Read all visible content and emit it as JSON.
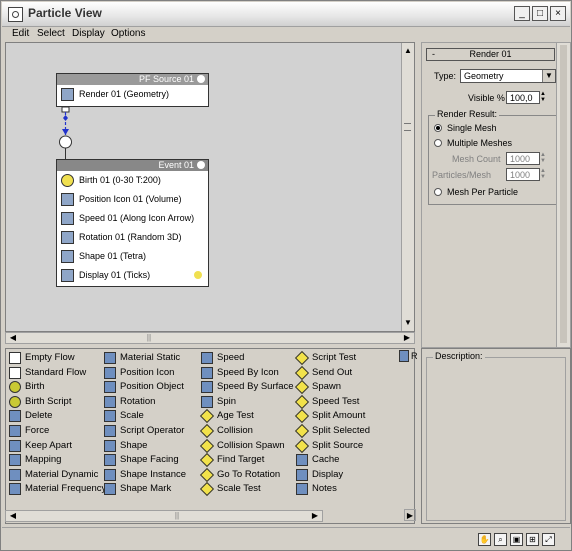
{
  "window": {
    "title": "Particle View"
  },
  "menu": [
    "Edit",
    "Select",
    "Display",
    "Options"
  ],
  "nodes": {
    "source": {
      "header": "PF Source 01",
      "rows": [
        {
          "label": "Render 01 (Geometry)",
          "icon": "render-icon"
        }
      ]
    },
    "event": {
      "header": "Event 01",
      "rows": [
        {
          "label": "Birth 01 (0-30 T:200)",
          "icon": "birth-icon"
        },
        {
          "label": "Position Icon 01 (Volume)",
          "icon": "position-icon"
        },
        {
          "label": "Speed 01 (Along Icon Arrow)",
          "icon": "speed-icon"
        },
        {
          "label": "Rotation 01 (Random 3D)",
          "icon": "rotation-icon"
        },
        {
          "label": "Shape 01 (Tetra)",
          "icon": "shape-icon"
        },
        {
          "label": "Display 01 (Ticks)",
          "icon": "display-icon"
        }
      ]
    }
  },
  "params": {
    "rollout_title": "Render 01",
    "rollout_toggle": "-",
    "type_label": "Type:",
    "type_value": "Geometry",
    "visible_label": "Visible %",
    "visible_value": "100,0",
    "render_result_label": "Render Result:",
    "options": [
      "Single Mesh",
      "Multiple Meshes"
    ],
    "mesh_count_label": "Mesh Count",
    "mesh_count_value": "1000",
    "particles_label": "Particles/Mesh",
    "particles_value": "1000",
    "mesh_per_particle": "Mesh Per Particle"
  },
  "depot": {
    "columns": [
      [
        {
          "label": "Empty Flow",
          "icon": "empty-flow-icon",
          "kind": "op"
        },
        {
          "label": "Standard Flow",
          "icon": "standard-flow-icon",
          "kind": "op"
        },
        {
          "label": "Birth",
          "icon": "birth-icon",
          "kind": "birth"
        },
        {
          "label": "Birth Script",
          "icon": "birth-script-icon",
          "kind": "birth"
        },
        {
          "label": "Delete",
          "icon": "delete-icon",
          "kind": "normal"
        },
        {
          "label": "Force",
          "icon": "force-icon",
          "kind": "normal"
        },
        {
          "label": "Keep Apart",
          "icon": "keep-apart-icon",
          "kind": "normal"
        },
        {
          "label": "Mapping",
          "icon": "mapping-icon",
          "kind": "normal"
        },
        {
          "label": "Material Dynamic",
          "icon": "material-dynamic-icon",
          "kind": "normal"
        },
        {
          "label": "Material Frequency",
          "icon": "material-frequency-icon",
          "kind": "normal"
        }
      ],
      [
        {
          "label": "Material Static",
          "icon": "material-static-icon",
          "kind": "normal"
        },
        {
          "label": "Position Icon",
          "icon": "position-icon",
          "kind": "normal"
        },
        {
          "label": "Position Object",
          "icon": "position-object-icon",
          "kind": "normal"
        },
        {
          "label": "Rotation",
          "icon": "rotation-icon",
          "kind": "normal"
        },
        {
          "label": "Scale",
          "icon": "scale-icon",
          "kind": "normal"
        },
        {
          "label": "Script Operator",
          "icon": "script-operator-icon",
          "kind": "normal"
        },
        {
          "label": "Shape",
          "icon": "shape-icon",
          "kind": "normal"
        },
        {
          "label": "Shape Facing",
          "icon": "shape-facing-icon",
          "kind": "normal"
        },
        {
          "label": "Shape Instance",
          "icon": "shape-instance-icon",
          "kind": "normal"
        },
        {
          "label": "Shape Mark",
          "icon": "shape-mark-icon",
          "kind": "normal"
        }
      ],
      [
        {
          "label": "Speed",
          "icon": "speed-icon",
          "kind": "normal"
        },
        {
          "label": "Speed By Icon",
          "icon": "speed-by-icon-icon",
          "kind": "normal"
        },
        {
          "label": "Speed By Surface",
          "icon": "speed-by-surface-icon",
          "kind": "normal"
        },
        {
          "label": "Spin",
          "icon": "spin-icon",
          "kind": "normal"
        },
        {
          "label": "Age Test",
          "icon": "age-test-icon",
          "kind": "test"
        },
        {
          "label": "Collision",
          "icon": "collision-icon",
          "kind": "test"
        },
        {
          "label": "Collision Spawn",
          "icon": "collision-spawn-icon",
          "kind": "test"
        },
        {
          "label": "Find Target",
          "icon": "find-target-icon",
          "kind": "test"
        },
        {
          "label": "Go To Rotation",
          "icon": "go-to-rotation-icon",
          "kind": "test"
        },
        {
          "label": "Scale Test",
          "icon": "scale-test-icon",
          "kind": "test"
        }
      ],
      [
        {
          "label": "Script Test",
          "icon": "script-test-icon",
          "kind": "test"
        },
        {
          "label": "Send Out",
          "icon": "send-out-icon",
          "kind": "test"
        },
        {
          "label": "Spawn",
          "icon": "spawn-icon",
          "kind": "test"
        },
        {
          "label": "Speed Test",
          "icon": "speed-test-icon",
          "kind": "test"
        },
        {
          "label": "Split Amount",
          "icon": "split-amount-icon",
          "kind": "test"
        },
        {
          "label": "Split Selected",
          "icon": "split-selected-icon",
          "kind": "test"
        },
        {
          "label": "Split Source",
          "icon": "split-source-icon",
          "kind": "test"
        },
        {
          "label": "Cache",
          "icon": "cache-icon",
          "kind": "normal"
        },
        {
          "label": "Display",
          "icon": "display-icon",
          "kind": "normal"
        },
        {
          "label": "Notes",
          "icon": "notes-icon",
          "kind": "normal"
        }
      ]
    ],
    "cut_label": "R"
  },
  "description": {
    "label": "Description:"
  }
}
